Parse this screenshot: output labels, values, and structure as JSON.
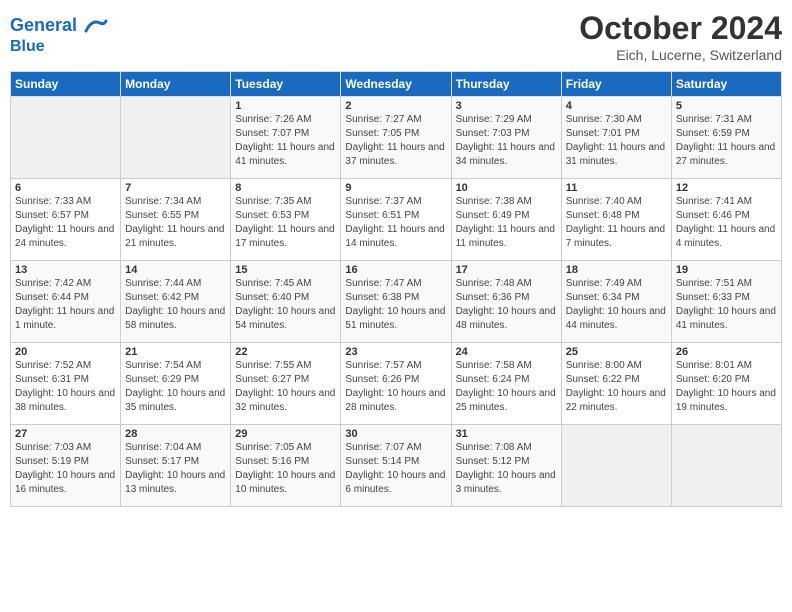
{
  "header": {
    "logo_line1": "General",
    "logo_line2": "Blue",
    "month": "October 2024",
    "location": "Eich, Lucerne, Switzerland"
  },
  "weekdays": [
    "Sunday",
    "Monday",
    "Tuesday",
    "Wednesday",
    "Thursday",
    "Friday",
    "Saturday"
  ],
  "weeks": [
    [
      {
        "day": "",
        "info": ""
      },
      {
        "day": "",
        "info": ""
      },
      {
        "day": "1",
        "info": "Sunrise: 7:26 AM\nSunset: 7:07 PM\nDaylight: 11 hours and 41 minutes."
      },
      {
        "day": "2",
        "info": "Sunrise: 7:27 AM\nSunset: 7:05 PM\nDaylight: 11 hours and 37 minutes."
      },
      {
        "day": "3",
        "info": "Sunrise: 7:29 AM\nSunset: 7:03 PM\nDaylight: 11 hours and 34 minutes."
      },
      {
        "day": "4",
        "info": "Sunrise: 7:30 AM\nSunset: 7:01 PM\nDaylight: 11 hours and 31 minutes."
      },
      {
        "day": "5",
        "info": "Sunrise: 7:31 AM\nSunset: 6:59 PM\nDaylight: 11 hours and 27 minutes."
      }
    ],
    [
      {
        "day": "6",
        "info": "Sunrise: 7:33 AM\nSunset: 6:57 PM\nDaylight: 11 hours and 24 minutes."
      },
      {
        "day": "7",
        "info": "Sunrise: 7:34 AM\nSunset: 6:55 PM\nDaylight: 11 hours and 21 minutes."
      },
      {
        "day": "8",
        "info": "Sunrise: 7:35 AM\nSunset: 6:53 PM\nDaylight: 11 hours and 17 minutes."
      },
      {
        "day": "9",
        "info": "Sunrise: 7:37 AM\nSunset: 6:51 PM\nDaylight: 11 hours and 14 minutes."
      },
      {
        "day": "10",
        "info": "Sunrise: 7:38 AM\nSunset: 6:49 PM\nDaylight: 11 hours and 11 minutes."
      },
      {
        "day": "11",
        "info": "Sunrise: 7:40 AM\nSunset: 6:48 PM\nDaylight: 11 hours and 7 minutes."
      },
      {
        "day": "12",
        "info": "Sunrise: 7:41 AM\nSunset: 6:46 PM\nDaylight: 11 hours and 4 minutes."
      }
    ],
    [
      {
        "day": "13",
        "info": "Sunrise: 7:42 AM\nSunset: 6:44 PM\nDaylight: 11 hours and 1 minute."
      },
      {
        "day": "14",
        "info": "Sunrise: 7:44 AM\nSunset: 6:42 PM\nDaylight: 10 hours and 58 minutes."
      },
      {
        "day": "15",
        "info": "Sunrise: 7:45 AM\nSunset: 6:40 PM\nDaylight: 10 hours and 54 minutes."
      },
      {
        "day": "16",
        "info": "Sunrise: 7:47 AM\nSunset: 6:38 PM\nDaylight: 10 hours and 51 minutes."
      },
      {
        "day": "17",
        "info": "Sunrise: 7:48 AM\nSunset: 6:36 PM\nDaylight: 10 hours and 48 minutes."
      },
      {
        "day": "18",
        "info": "Sunrise: 7:49 AM\nSunset: 6:34 PM\nDaylight: 10 hours and 44 minutes."
      },
      {
        "day": "19",
        "info": "Sunrise: 7:51 AM\nSunset: 6:33 PM\nDaylight: 10 hours and 41 minutes."
      }
    ],
    [
      {
        "day": "20",
        "info": "Sunrise: 7:52 AM\nSunset: 6:31 PM\nDaylight: 10 hours and 38 minutes."
      },
      {
        "day": "21",
        "info": "Sunrise: 7:54 AM\nSunset: 6:29 PM\nDaylight: 10 hours and 35 minutes."
      },
      {
        "day": "22",
        "info": "Sunrise: 7:55 AM\nSunset: 6:27 PM\nDaylight: 10 hours and 32 minutes."
      },
      {
        "day": "23",
        "info": "Sunrise: 7:57 AM\nSunset: 6:26 PM\nDaylight: 10 hours and 28 minutes."
      },
      {
        "day": "24",
        "info": "Sunrise: 7:58 AM\nSunset: 6:24 PM\nDaylight: 10 hours and 25 minutes."
      },
      {
        "day": "25",
        "info": "Sunrise: 8:00 AM\nSunset: 6:22 PM\nDaylight: 10 hours and 22 minutes."
      },
      {
        "day": "26",
        "info": "Sunrise: 8:01 AM\nSunset: 6:20 PM\nDaylight: 10 hours and 19 minutes."
      }
    ],
    [
      {
        "day": "27",
        "info": "Sunrise: 7:03 AM\nSunset: 5:19 PM\nDaylight: 10 hours and 16 minutes."
      },
      {
        "day": "28",
        "info": "Sunrise: 7:04 AM\nSunset: 5:17 PM\nDaylight: 10 hours and 13 minutes."
      },
      {
        "day": "29",
        "info": "Sunrise: 7:05 AM\nSunset: 5:16 PM\nDaylight: 10 hours and 10 minutes."
      },
      {
        "day": "30",
        "info": "Sunrise: 7:07 AM\nSunset: 5:14 PM\nDaylight: 10 hours and 6 minutes."
      },
      {
        "day": "31",
        "info": "Sunrise: 7:08 AM\nSunset: 5:12 PM\nDaylight: 10 hours and 3 minutes."
      },
      {
        "day": "",
        "info": ""
      },
      {
        "day": "",
        "info": ""
      }
    ]
  ]
}
